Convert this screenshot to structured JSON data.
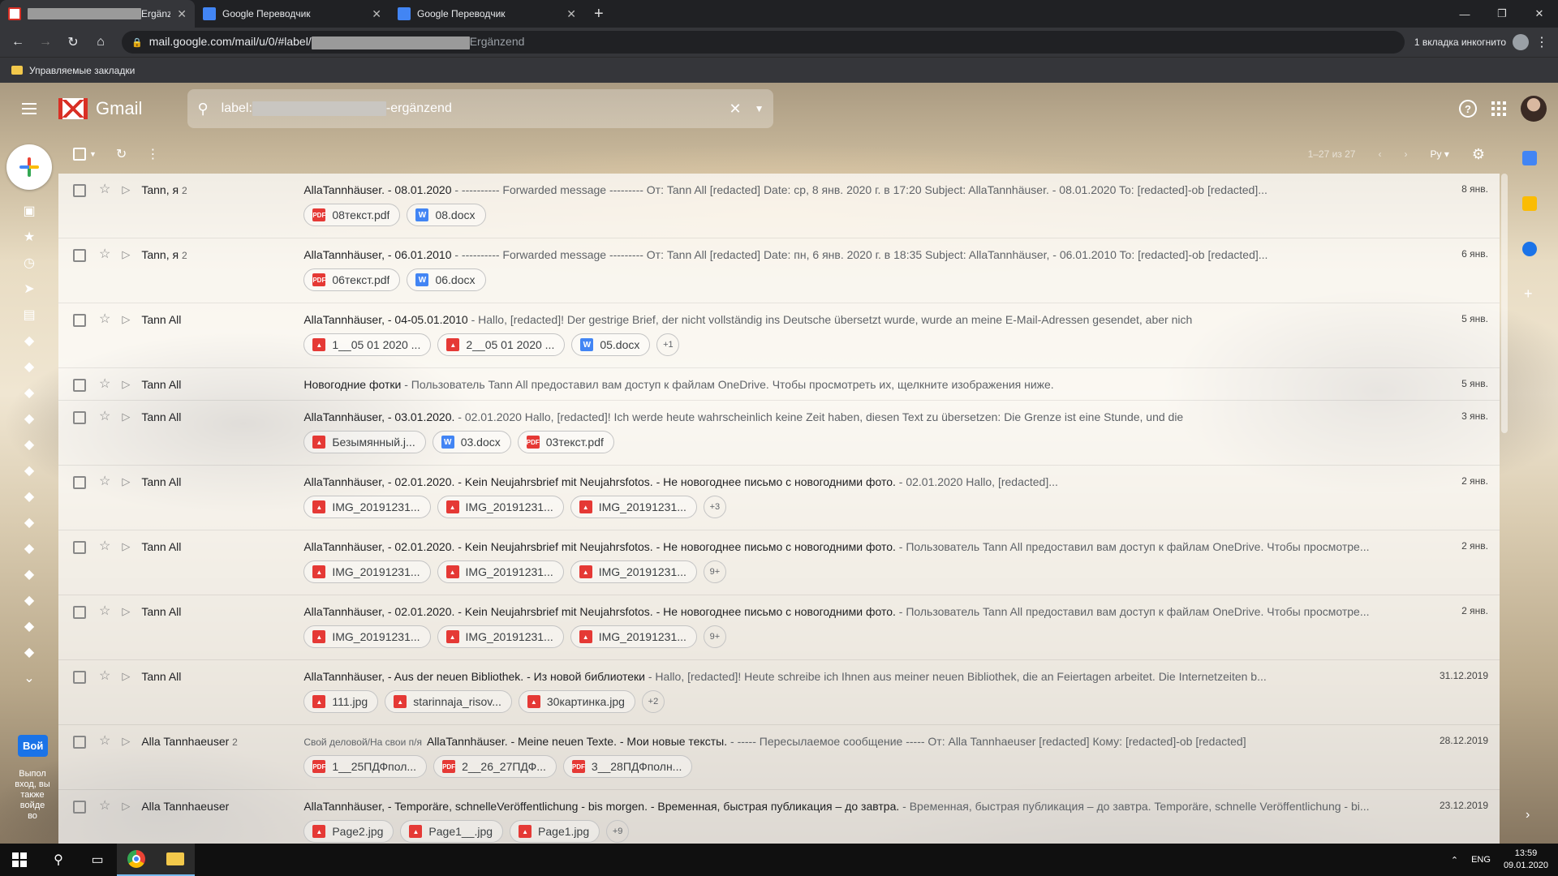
{
  "browser": {
    "tabs": [
      {
        "title_suffix": "Ergänze",
        "active": true
      },
      {
        "title": "Google Переводчик"
      },
      {
        "title": "Google Переводчик"
      }
    ],
    "url_prefix": "mail.google.com/mail/u/0/#label/",
    "url_suffix": "Ergänzend",
    "incognito": "1 вкладка инкогнито",
    "bookmark": "Управляемые закладки"
  },
  "gmail": {
    "app_name": "Gmail",
    "search_prefix": "label:",
    "search_suffix": "-ergänzend",
    "pagination": "1–27 из 27",
    "input_tool": "Ру",
    "hangouts_btn": "Вой",
    "hangouts_note": "Выпол вход, вы также войде во"
  },
  "messages": [
    {
      "sender": "Tann, я",
      "count": "2",
      "subject": "AllaTannhäuser. - 08.01.2020",
      "snippet": " - ---------- Forwarded message --------- От: Tann All [redacted] Date: ср, 8 янв. 2020 г. в 17:20 Subject: AllaTannhäuser. - 08.01.2020 To: [redacted]-ob [redacted]...",
      "date": "8 янв.",
      "attachments": [
        {
          "name": "08текст.pdf",
          "type": "pdf"
        },
        {
          "name": "08.docx",
          "type": "doc"
        }
      ]
    },
    {
      "sender": "Tann, я",
      "count": "2",
      "subject": "AllaTannhäuser, - 06.01.2010",
      "snippet": " - ---------- Forwarded message --------- От: Tann All [redacted] Date: пн, 6 янв. 2020 г. в 18:35 Subject: AllaTannhäuser, - 06.01.2010 To: [redacted]-ob [redacted]...",
      "date": "6 янв.",
      "attachments": [
        {
          "name": "06текст.pdf",
          "type": "pdf"
        },
        {
          "name": "06.docx",
          "type": "doc"
        }
      ]
    },
    {
      "sender": "Tann All",
      "subject": "AllaTannhäuser, - 04-05.01.2010",
      "snippet": " - Hallo, [redacted]! Der gestrige Brief, der nicht vollständig ins Deutsche übersetzt wurde, wurde an meine E-Mail-Adressen gesendet, aber nich",
      "date": "5 янв.",
      "attachments": [
        {
          "name": "1__05 01 2020 ...",
          "type": "img"
        },
        {
          "name": "2__05 01 2020 ...",
          "type": "img"
        },
        {
          "name": "05.docx",
          "type": "doc"
        }
      ],
      "more": "+1"
    },
    {
      "sender": "Tann All",
      "subject": "Новогодние фотки",
      "snippet": " - Пользователь Tann All предоставил вам доступ к файлам OneDrive. Чтобы просмотреть их, щелкните изображения ниже.",
      "date": "5 янв.",
      "short": true
    },
    {
      "sender": "Tann All",
      "subject": "AllaTannhäuser, - 03.01.2020.",
      "snippet": " - 02.01.2020 Hallo, [redacted]! Ich werde heute wahrscheinlich keine Zeit haben, diesen Text zu übersetzen: Die Grenze ist eine Stunde, und die",
      "date": "3 янв.",
      "attachments": [
        {
          "name": "Безымянный.j...",
          "type": "img"
        },
        {
          "name": "03.docx",
          "type": "doc"
        },
        {
          "name": "03текст.pdf",
          "type": "pdf"
        }
      ]
    },
    {
      "sender": "Tann All",
      "subject": "AllaTannhäuser, - 02.01.2020. - Kein Neujahrsbrief mit Neujahrsfotos. - Не новогоднее письмо с новогодними фото.",
      "snippet": " - 02.01.2020 Hallo, [redacted]...",
      "date": "2 янв.",
      "attachments": [
        {
          "name": "IMG_20191231...",
          "type": "img"
        },
        {
          "name": "IMG_20191231...",
          "type": "img"
        },
        {
          "name": "IMG_20191231...",
          "type": "img"
        }
      ],
      "more": "+3"
    },
    {
      "sender": "Tann All",
      "subject": "AllaTannhäuser, - 02.01.2020. - Kein Neujahrsbrief mit Neujahrsfotos. - Не новогоднее письмо с новогодними фото.",
      "snippet": " - Пользователь Tann All предоставил вам доступ к файлам OneDrive. Чтобы просмотре...",
      "date": "2 янв.",
      "attachments": [
        {
          "name": "IMG_20191231...",
          "type": "img"
        },
        {
          "name": "IMG_20191231...",
          "type": "img"
        },
        {
          "name": "IMG_20191231...",
          "type": "img"
        }
      ],
      "more": "9+"
    },
    {
      "sender": "Tann All",
      "subject": "AllaTannhäuser, - 02.01.2020. - Kein Neujahrsbrief mit Neujahrsfotos. - Не новогоднее письмо с новогодними фото.",
      "snippet": " - Пользователь Tann All предоставил вам доступ к файлам OneDrive. Чтобы просмотре...",
      "date": "2 янв.",
      "attachments": [
        {
          "name": "IMG_20191231...",
          "type": "img"
        },
        {
          "name": "IMG_20191231...",
          "type": "img"
        },
        {
          "name": "IMG_20191231...",
          "type": "img"
        }
      ],
      "more": "9+"
    },
    {
      "sender": "Tann All",
      "subject": "AllaTannhäuser, - Aus der neuen Bibliothek. - Из новой библиотеки",
      "snippet": " - Hallo, [redacted]! Heute schreibe ich Ihnen aus meiner neuen Bibliothek, die an Feiertagen arbeitet. Die Internetzeiten b...",
      "date": "31.12.2019",
      "attachments": [
        {
          "name": "111.jpg",
          "type": "img"
        },
        {
          "name": "starinnaja_risov...",
          "type": "img"
        },
        {
          "name": "30картинка.jpg",
          "type": "img"
        }
      ],
      "more": "+2"
    },
    {
      "sender": "Alla Tannhaeuser",
      "count": "2",
      "label": "Свой деловой/На свои п/я",
      "subject": "AllaTannhäuser. - Meine neuen Texte. - Мои новые тексты.",
      "snippet": " - ----- Пересылаемое сообщение ----- От: Alla Tannhaeuser [redacted] Кому: [redacted]-ob [redacted]",
      "date": "28.12.2019",
      "attachments": [
        {
          "name": "1__25ПДФпол...",
          "type": "pdf"
        },
        {
          "name": "2__26_27ПДФ...",
          "type": "pdf"
        },
        {
          "name": "3__28ПДФполн...",
          "type": "pdf"
        }
      ]
    },
    {
      "sender": "Alla Tannhaeuser",
      "subject": "AllaTannhäuser, - Temporäre, schnelleVeröffentlichung - bis morgen. - Временная, быстрая публикация – до завтра.",
      "snippet": " - Временная, быстрая публикация – до завтра. Temporäre, schnelle Veröffentlichung - bi...",
      "date": "23.12.2019",
      "attachments": [
        {
          "name": "Page2.jpg",
          "type": "img"
        },
        {
          "name": "Page1__.jpg",
          "type": "img"
        },
        {
          "name": "Page1.jpg",
          "type": "img"
        }
      ],
      "more": "+9"
    }
  ],
  "taskbar": {
    "lang": "ENG",
    "time": "13:59",
    "date": "09.01.2020"
  }
}
